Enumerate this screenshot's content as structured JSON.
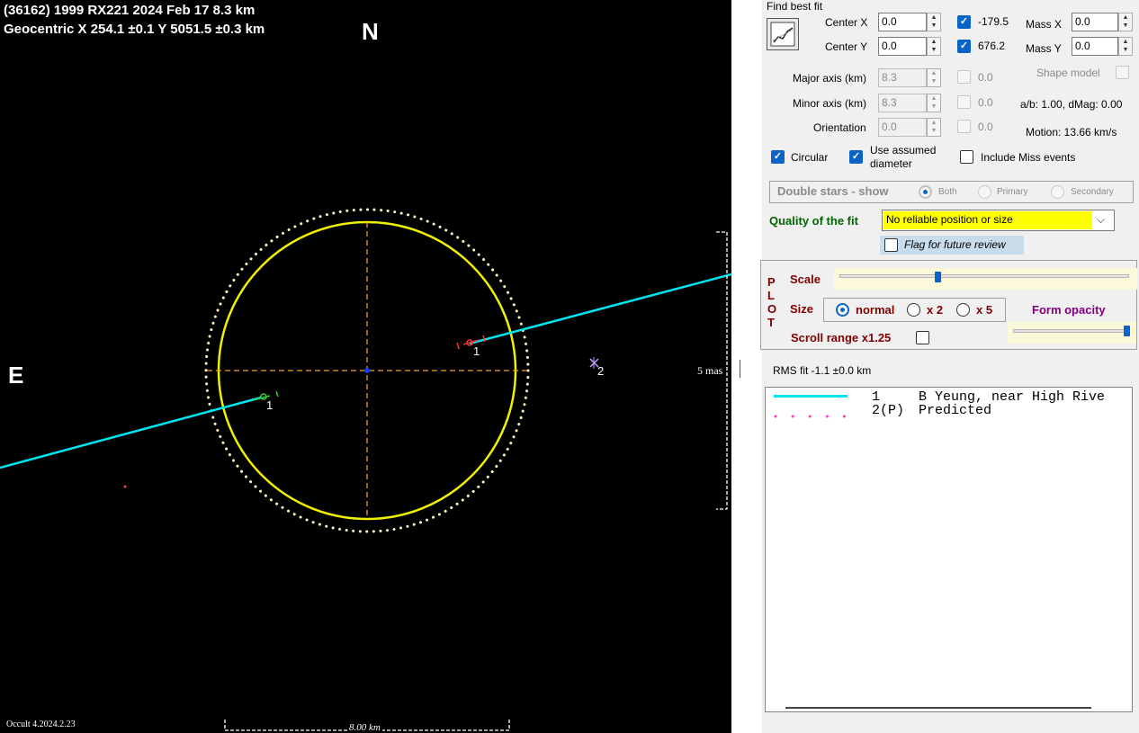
{
  "plot": {
    "header_line1": "(36162) 1999 RX221  2024 Feb 17  8.3 km",
    "header_line2": "Geocentric  X  254.1 ±0.1  Y 5051.5 ±0.3 km",
    "north": "N",
    "east": "E",
    "chord1_label_a": "1",
    "chord1_label_b": "1",
    "point2_label": "2",
    "mas_label": "5 mas",
    "scale_label": "8.00 km",
    "version": "Occult 4.2024.2.23",
    "colors": {
      "ellipse": "#f0f000",
      "chord": "#00e5f0",
      "axes": "#f0a030",
      "limb_dots": "#fff8c0"
    }
  },
  "panel": {
    "find_best_fit": "Find best fit",
    "fit_icon": "chart-fit-icon",
    "center_x_label": "Center X",
    "center_x_value": "0.0",
    "center_x_fit": "-179.5",
    "center_y_label": "Center Y",
    "center_y_value": "0.0",
    "center_y_fit": "676.2",
    "mass_x_label": "Mass X",
    "mass_x_value": "0.0",
    "mass_y_label": "Mass Y",
    "mass_y_value": "0.0",
    "major_label": "Major axis (km)",
    "major_value": "8.3",
    "major_fit": "0.0",
    "minor_label": "Minor axis (km)",
    "minor_value": "8.3",
    "minor_fit": "0.0",
    "orient_label": "Orientation",
    "orient_value": "0.0",
    "orient_fit": "0.0",
    "shape_model": "Shape model",
    "ab_text": "a/b: 1.00, dMag: 0.00",
    "motion_text": "Motion: 13.66 km/s",
    "circular": "Circular",
    "use_assumed_1": "Use assumed",
    "use_assumed_2": "diameter",
    "include_miss": "Include Miss events",
    "double_stars": "Double stars - show",
    "ds_both": "Both",
    "ds_primary": "Primary",
    "ds_secondary": "Secondary",
    "quality_label": "Quality of the fit",
    "quality_value": "No reliable position or size",
    "flag_review": "Flag for future review",
    "plot_letters": [
      "P",
      "L",
      "O",
      "T"
    ],
    "scale_label": "Scale",
    "size_label": "Size",
    "size_normal": "normal",
    "size_x2": "x 2",
    "size_x5": "x 5",
    "form_opacity": "Form opacity",
    "scroll_range": "Scroll range x1.25",
    "scale_level": 0.33,
    "opacity_level": 1.0,
    "rms_fit": "RMS fit -1.1 ±0.0 km",
    "legend": [
      {
        "num": "1",
        "name": "B Yeung, near High Rive",
        "style": "solid"
      },
      {
        "num": "2(P)",
        "name": "Predicted",
        "style": "dots"
      }
    ],
    "colors": {
      "accent": "#0a64c8",
      "quality_bg": "#ffff00",
      "quality_label": "#006400",
      "plot_label": "#800000",
      "opacity_label": "#800080"
    }
  }
}
